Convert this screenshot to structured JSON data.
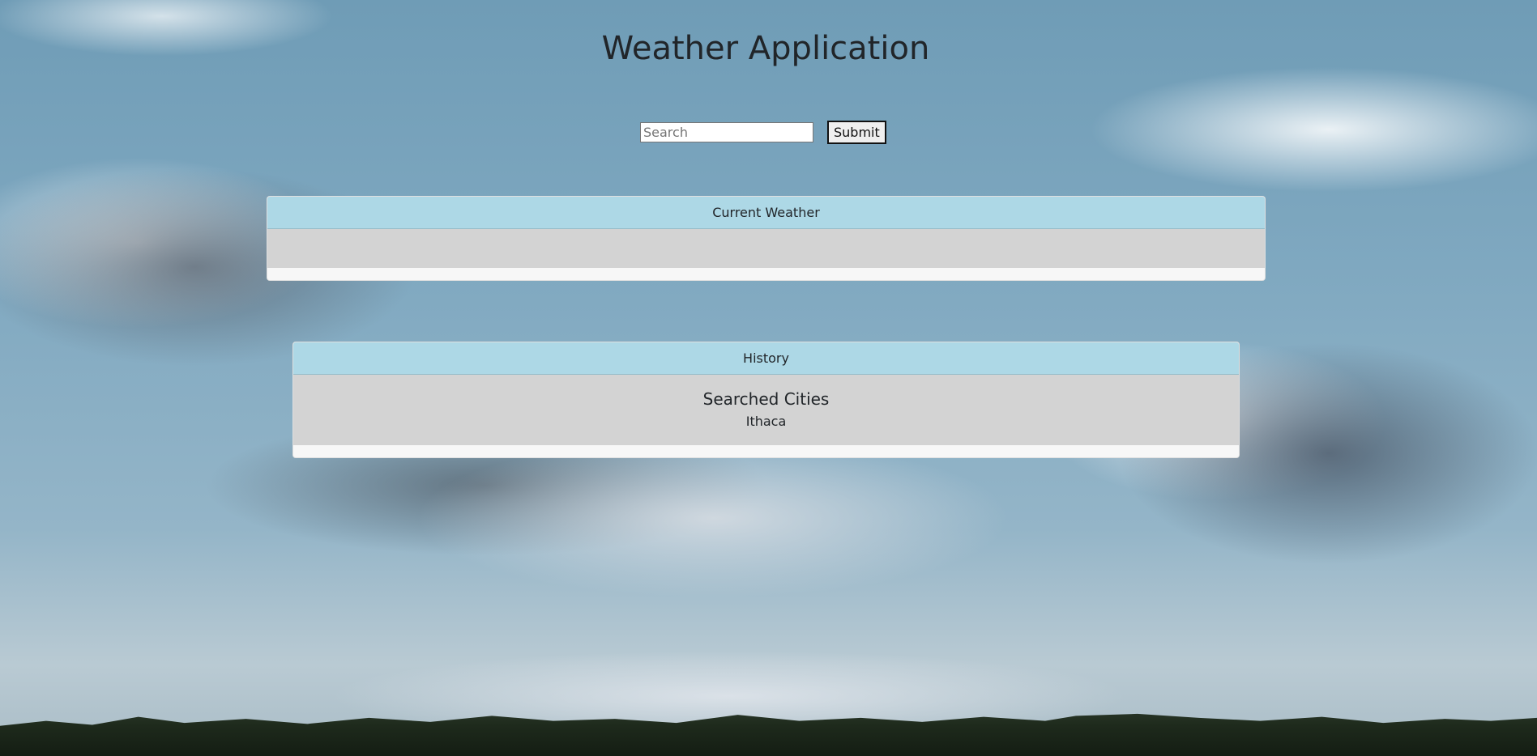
{
  "app": {
    "title": "Weather Application"
  },
  "search": {
    "placeholder": "Search",
    "value": "",
    "submit_label": "Submit"
  },
  "current_weather": {
    "header": "Current Weather"
  },
  "history": {
    "header": "History",
    "heading": "Searched Cities",
    "cities": [
      "Ithaca"
    ]
  },
  "theme": {
    "card_header_color": "#add8e6",
    "card_body_color": "#d3d3d3"
  }
}
